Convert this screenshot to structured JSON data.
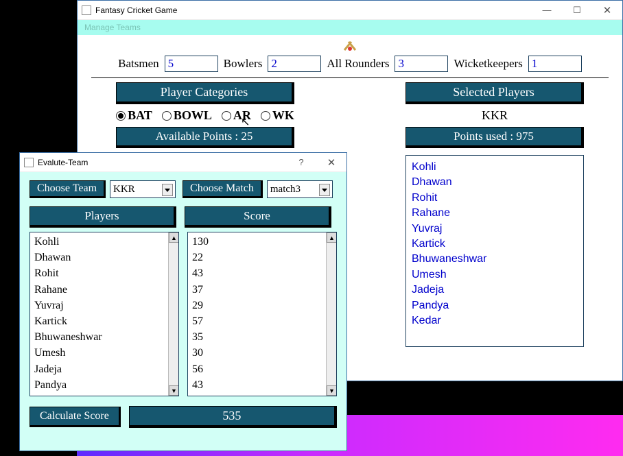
{
  "main_window": {
    "title": "Fantasy Cricket Game",
    "menu": "Manage Teams",
    "counts": {
      "batsmen_label": "Batsmen",
      "batsmen": "5",
      "bowlers_label": "Bowlers",
      "bowlers": "2",
      "allrounders_label": "All Rounders",
      "allrounders": "3",
      "wk_label": "Wicketkeepers",
      "wk": "1"
    },
    "categories_header": "Player Categories",
    "radios": {
      "bat": "BAT",
      "bowl": "BOWL",
      "ar": "AR",
      "wk": "WK",
      "selected": "bat"
    },
    "available_points": "Available Points : 25",
    "selected_header": "Selected Players",
    "team_name": "KKR",
    "points_used": "Points used : 975",
    "selected_players": [
      "Kohli",
      "Dhawan",
      "Rohit",
      "Rahane",
      "Yuvraj",
      "Kartick",
      "Bhuwaneshwar",
      "Umesh",
      "Jadeja",
      "Pandya",
      "Kedar"
    ]
  },
  "dialog": {
    "title": "Evalute-Team",
    "help_icon": "?",
    "close_icon": "✕",
    "choose_team_btn": "Choose Team",
    "team_value": "KKR",
    "choose_match_btn": "Choose Match",
    "match_value": "match3",
    "players_header": "Players",
    "score_header": "Score",
    "players": [
      "Kohli",
      "Dhawan",
      "Rohit",
      "Rahane",
      "Yuvraj",
      "Kartick",
      "Bhuwaneshwar",
      "Umesh",
      "Jadeja",
      "Pandya"
    ],
    "scores": [
      "130",
      "22",
      "43",
      "37",
      "29",
      "57",
      "35",
      "30",
      "56",
      "43"
    ],
    "calc_btn": "Calculate Score",
    "total": "535"
  },
  "win_controls": {
    "min": "—",
    "max": "☐",
    "close": "✕"
  }
}
